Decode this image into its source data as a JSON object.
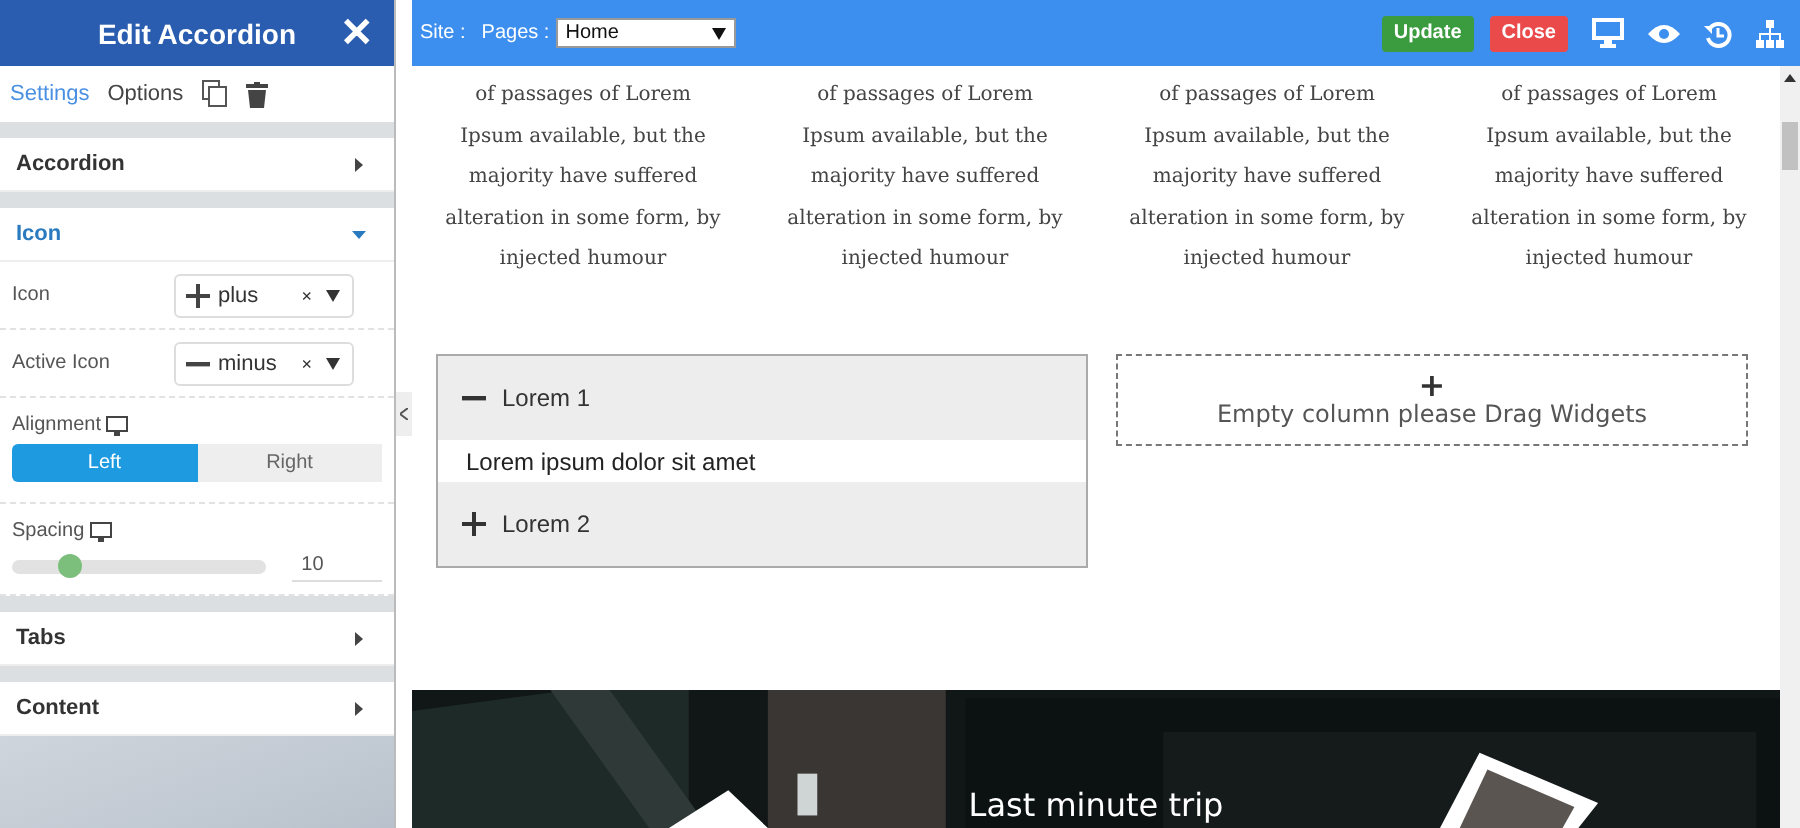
{
  "panel": {
    "title": "Edit Accordion",
    "close": "✕",
    "tabs": [
      {
        "label": "Settings",
        "selected": true
      },
      {
        "label": "Options",
        "selected": false
      }
    ],
    "sections": [
      {
        "title": "Accordion",
        "expanded": false
      },
      {
        "title": "Icon",
        "expanded": true
      },
      {
        "title": "Tabs",
        "expanded": false
      },
      {
        "title": "Content",
        "expanded": false
      }
    ],
    "icon_fields": [
      {
        "label": "Icon",
        "value": "plus",
        "kind": "plus",
        "clear": "×"
      },
      {
        "label": "Active Icon",
        "value": "minus",
        "kind": "minus",
        "clear": "×"
      }
    ],
    "alignment": {
      "label": "Alignment",
      "options": [
        {
          "label": "Left",
          "selected": true
        },
        {
          "label": "Right",
          "selected": false
        }
      ]
    },
    "spacing": {
      "label": "Spacing",
      "level": 0.23,
      "value": "10"
    }
  },
  "topbar": {
    "site_label": "Site :",
    "pages_label": "Pages :",
    "page": "Home",
    "update": "Update",
    "close": "Close"
  },
  "columns": [
    {
      "lines": [
        "of passages of Lorem",
        "Ipsum available, but the",
        "majority have suffered",
        "alteration in some form, by",
        "injected humour"
      ]
    },
    {
      "lines": [
        "of passages of Lorem",
        "Ipsum available, but the",
        "majority have suffered",
        "alteration in some form, by",
        "injected humour"
      ]
    },
    {
      "lines": [
        "of passages of Lorem",
        "Ipsum available, but the",
        "majority have suffered",
        "alteration in some form, by",
        "injected humour"
      ]
    },
    {
      "lines": [
        "of passages of Lorem",
        "Ipsum available, but the",
        "majority have suffered",
        "alteration in some form, by",
        "injected humour"
      ]
    }
  ],
  "accordion": [
    {
      "title": "Lorem 1",
      "expanded": true,
      "body": "Lorem ipsum dolor sit amet"
    },
    {
      "title": "Lorem 2",
      "expanded": false
    }
  ],
  "empty_column": {
    "plus": "+",
    "text": "Empty column please Drag Widgets"
  },
  "banner": {
    "kind": "picture",
    "title": "Last minute trip"
  }
}
